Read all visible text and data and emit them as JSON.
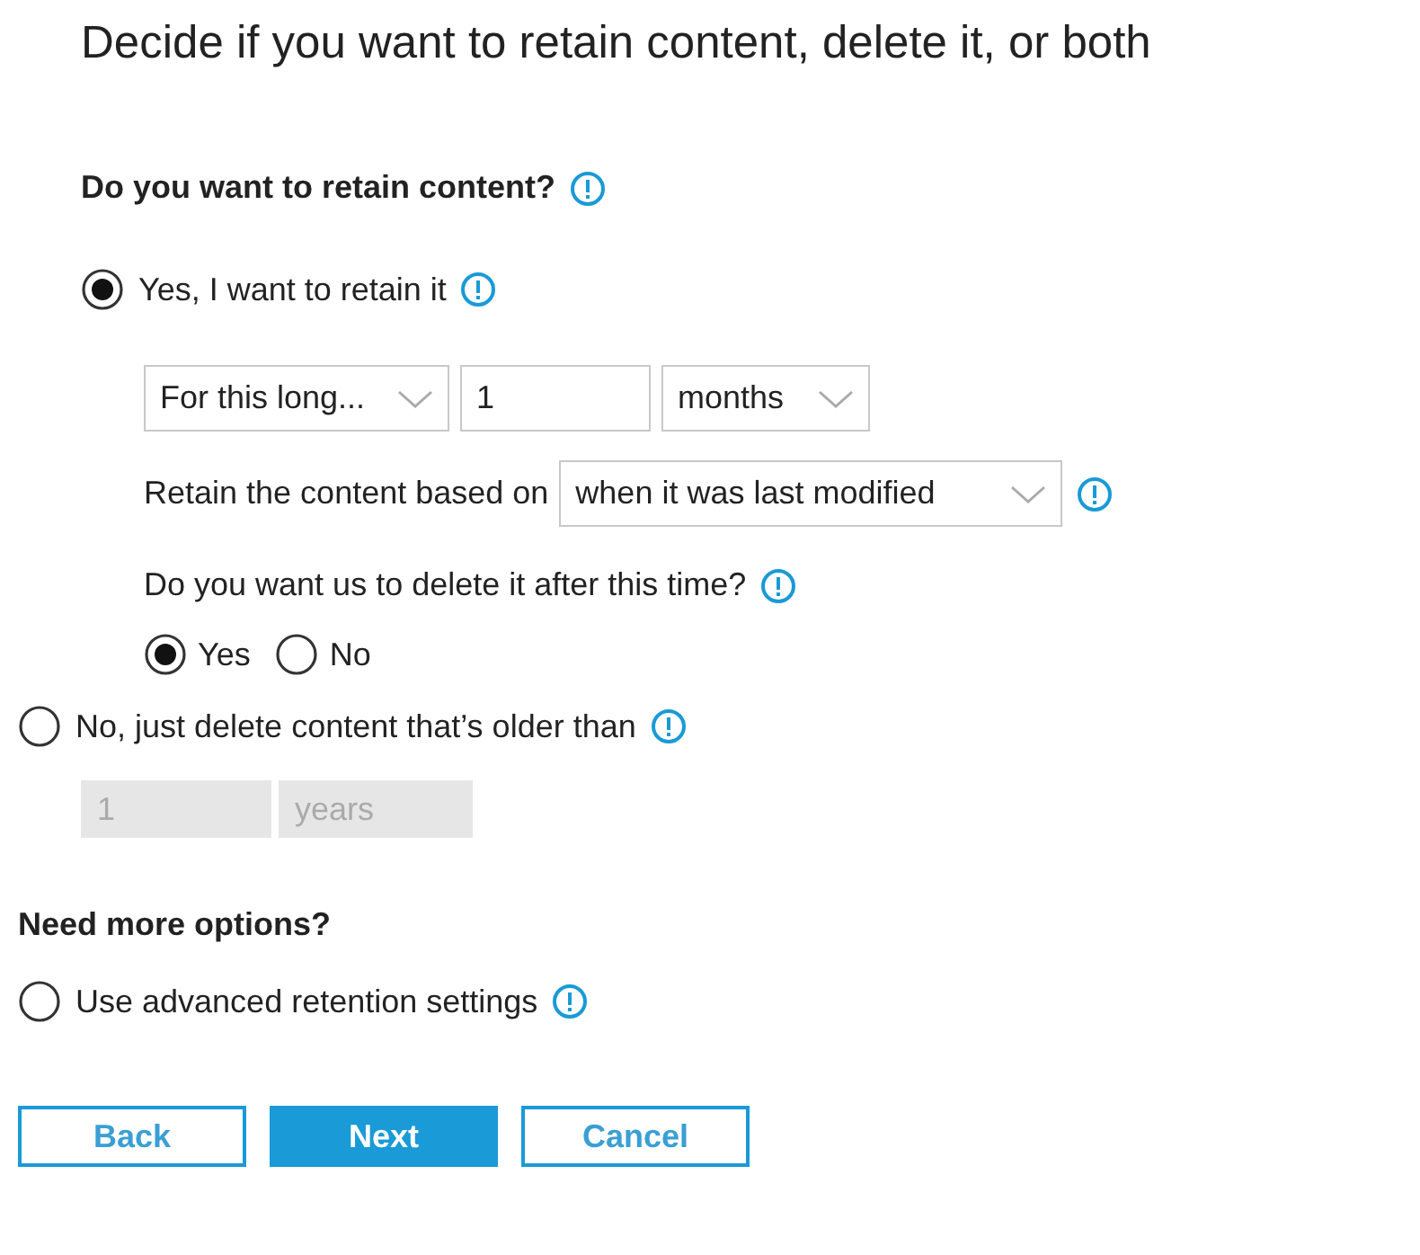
{
  "title": "Decide if you want to retain content, delete it, or both",
  "retain_question": {
    "label": "Do you want to retain content?"
  },
  "retain_option": {
    "label": "Yes, I want to retain it",
    "selected": true
  },
  "duration": {
    "type": "For this long...",
    "value": "1",
    "unit": "months"
  },
  "based_on": {
    "label": "Retain the content based on",
    "value": "when it was last modified"
  },
  "delete_question": {
    "label": "Do you want us to delete it after this time?",
    "options": [
      {
        "label": "Yes",
        "selected": true
      },
      {
        "label": "No",
        "selected": false
      }
    ]
  },
  "delete_only_option": {
    "label": "No, just delete content that’s older than",
    "selected": false
  },
  "delete_only_fields": {
    "value": "1",
    "unit": "years",
    "disabled": true
  },
  "more_options": {
    "heading": "Need more options?",
    "option": {
      "label": "Use advanced retention settings",
      "selected": false
    }
  },
  "buttons": [
    {
      "label": "Back",
      "kind": "secondary"
    },
    {
      "label": "Next",
      "kind": "primary"
    },
    {
      "label": "Cancel",
      "kind": "secondary"
    }
  ]
}
